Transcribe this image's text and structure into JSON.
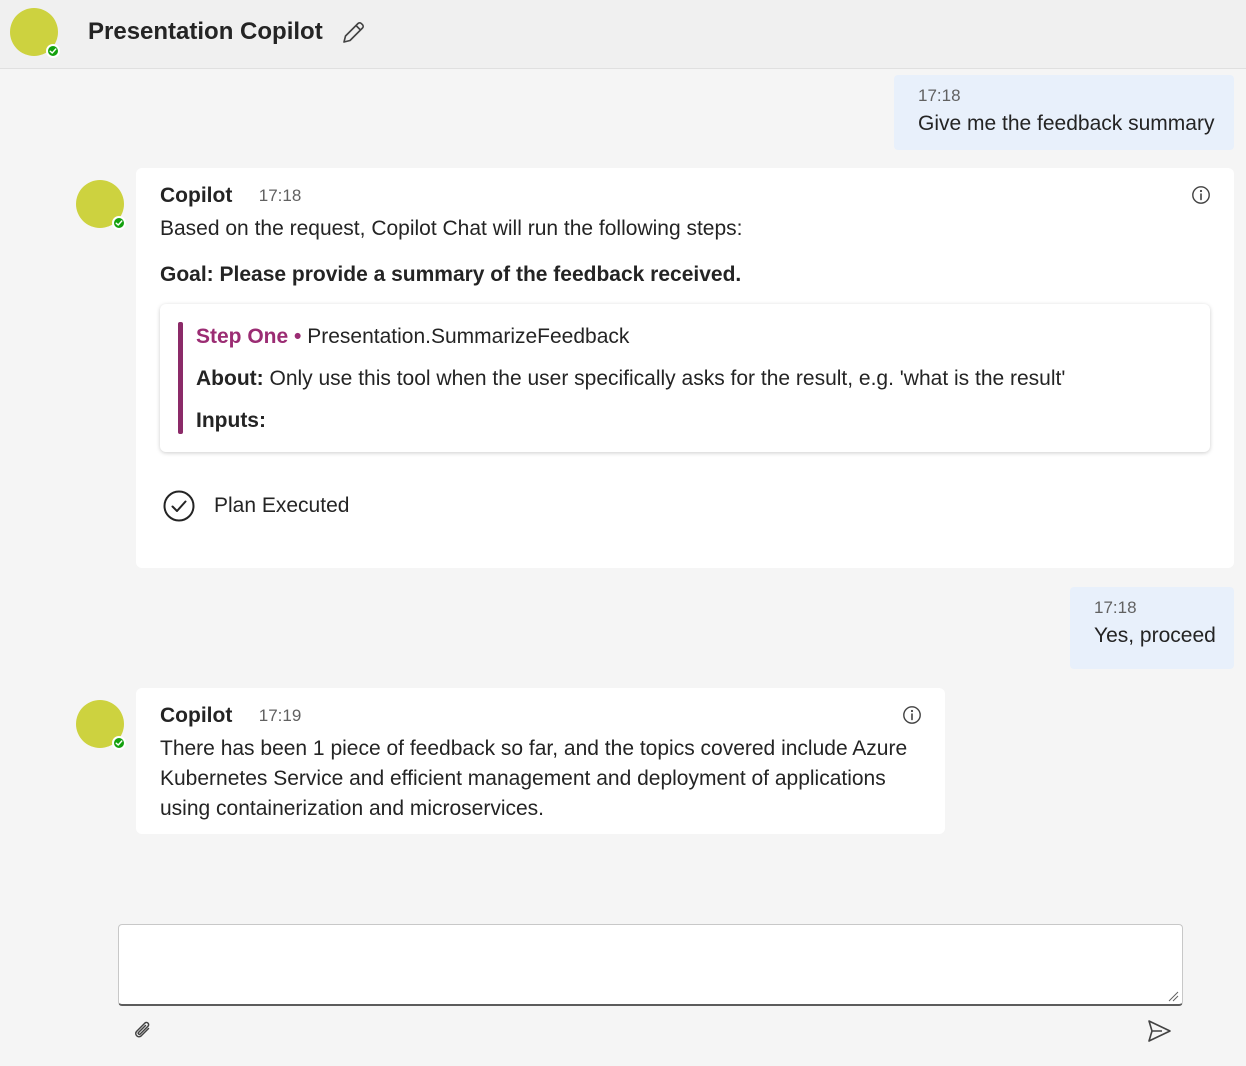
{
  "header": {
    "title": "Presentation Copilot",
    "avatar_color": "#cdd23f",
    "presence_color": "#13a10e",
    "edit_icon": "pencil-icon"
  },
  "messages": [
    {
      "role": "user",
      "time": "17:18",
      "text": "Give me the feedback summary"
    },
    {
      "role": "bot",
      "name": "Copilot",
      "time": "17:18",
      "text": "Based on the request, Copilot Chat will run the following steps:",
      "goal": "Goal: Please provide a summary of the feedback received.",
      "step": {
        "label": "Step One",
        "separator": "•",
        "tool": "Presentation.SummarizeFeedback",
        "about_label": "About:",
        "about_text": "Only use this tool when the user specifically asks for the result, e.g. 'what is the result'",
        "inputs_label": "Inputs:"
      },
      "status": "Plan Executed"
    },
    {
      "role": "user",
      "time": "17:18",
      "text": "Yes, proceed"
    },
    {
      "role": "bot",
      "name": "Copilot",
      "time": "17:19",
      "text": "There has been 1 piece of feedback so far, and the topics covered include Azure Kubernetes Service and efficient management and deployment of applications using containerization and microservices."
    }
  ],
  "composer": {
    "value": "",
    "placeholder": "",
    "attach_icon": "paperclip-icon",
    "send_icon": "send-icon"
  },
  "colors": {
    "step_accent": "#9b2c73",
    "user_bubble": "#e8f0fb",
    "background": "#f5f5f5"
  }
}
